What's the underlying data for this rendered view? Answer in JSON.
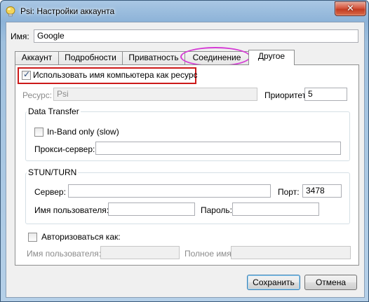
{
  "window": {
    "title": "Psi: Настройки аккаунта"
  },
  "name": {
    "label": "Имя:",
    "value": "Google"
  },
  "tabs": [
    "Аккаунт",
    "Подробности",
    "Приватность",
    "Соединение",
    "Другое"
  ],
  "active_tab": "Другое",
  "use_computer_name": {
    "label": "Использовать имя компьютера как ресурс",
    "checked": true
  },
  "resource": {
    "label": "Ресурс:",
    "value": "Psi"
  },
  "priority": {
    "label": "Приоритет:",
    "value": "5"
  },
  "data_transfer": {
    "title": "Data Transfer",
    "inband": {
      "label": "In-Band only (slow)",
      "checked": false
    },
    "proxy": {
      "label": "Прокси-сервер:",
      "value": ""
    }
  },
  "stun": {
    "title": "STUN/TURN",
    "server": {
      "label": "Сервер:",
      "value": ""
    },
    "port": {
      "label": "Порт:",
      "value": "3478"
    },
    "username": {
      "label": "Имя пользователя:",
      "value": ""
    },
    "password": {
      "label": "Пароль:",
      "value": ""
    }
  },
  "authorize": {
    "label": "Авторизоваться как:",
    "checked": false,
    "username_label": "Имя пользователя:",
    "fullname_label": "Полное имя:"
  },
  "buttons": {
    "save": "Сохранить",
    "cancel": "Отмена"
  }
}
